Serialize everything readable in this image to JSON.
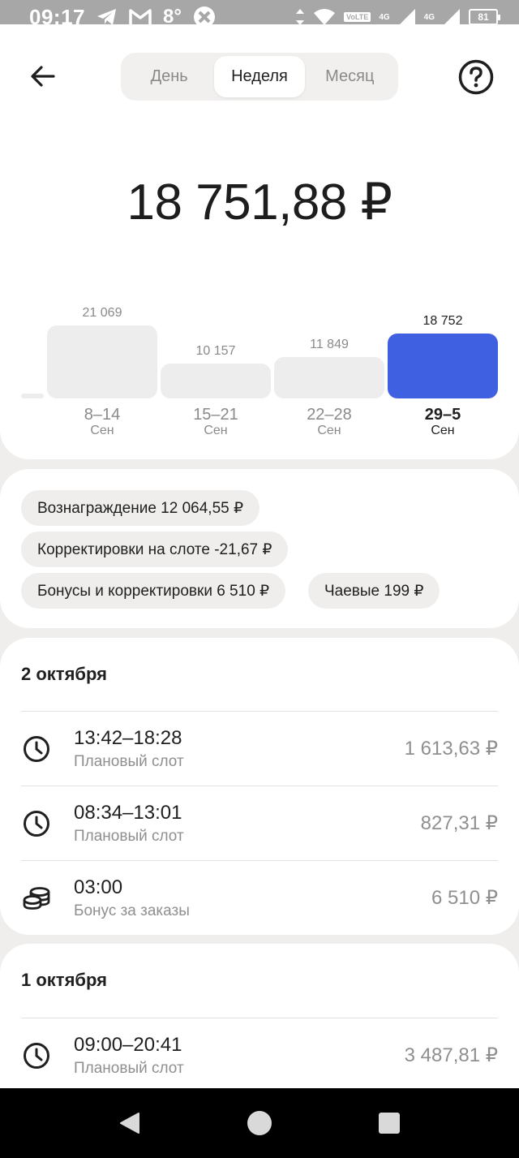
{
  "status_bar": {
    "time": "09:17",
    "temperature": "8°",
    "net1": "4G",
    "net2": "4G",
    "volte": "VoLTE",
    "battery": "81"
  },
  "header": {
    "tabs": [
      {
        "label": "День",
        "active": false
      },
      {
        "label": "Неделя",
        "active": true
      },
      {
        "label": "Месяц",
        "active": false
      }
    ]
  },
  "summary": {
    "total": "18 751,88 ₽"
  },
  "chart_data": {
    "type": "bar",
    "categories": [
      "8–14 Сен",
      "15–21 Сен",
      "22–28 Сен",
      "29–5 Сен"
    ],
    "values": [
      21069,
      10157,
      11849,
      18752
    ],
    "value_labels": [
      "21 069",
      "10 157",
      "11 849",
      "18 752"
    ],
    "ranges": [
      "8–14",
      "15–21",
      "22–28",
      "29–5"
    ],
    "months": [
      "Сен",
      "Сен",
      "Сен",
      "Сен"
    ],
    "active_index": 3,
    "active_color": "#3f60e0",
    "bar_color": "#ededed"
  },
  "breakdown": {
    "chips": [
      "Вознаграждение 12 064,55 ₽",
      "Корректировки на слоте -21,67 ₽",
      "Бонусы и корректировки 6 510 ₽",
      "Чаевые 199 ₽"
    ]
  },
  "days": [
    {
      "title": "2 октября",
      "items": [
        {
          "icon": "clock-icon",
          "title": "13:42–18:28",
          "subtitle": "Плановый слот",
          "amount": "1 613,63 ₽"
        },
        {
          "icon": "clock-icon",
          "title": "08:34–13:01",
          "subtitle": "Плановый слот",
          "amount": "827,31 ₽"
        },
        {
          "icon": "coins-icon",
          "title": "03:00",
          "subtitle": "Бонус за заказы",
          "amount": "6 510 ₽"
        }
      ]
    },
    {
      "title": "1 октября",
      "items": [
        {
          "icon": "clock-icon",
          "title": "09:00–20:41",
          "subtitle": "Плановый слот",
          "amount": "3 487,81 ₽"
        }
      ]
    }
  ]
}
